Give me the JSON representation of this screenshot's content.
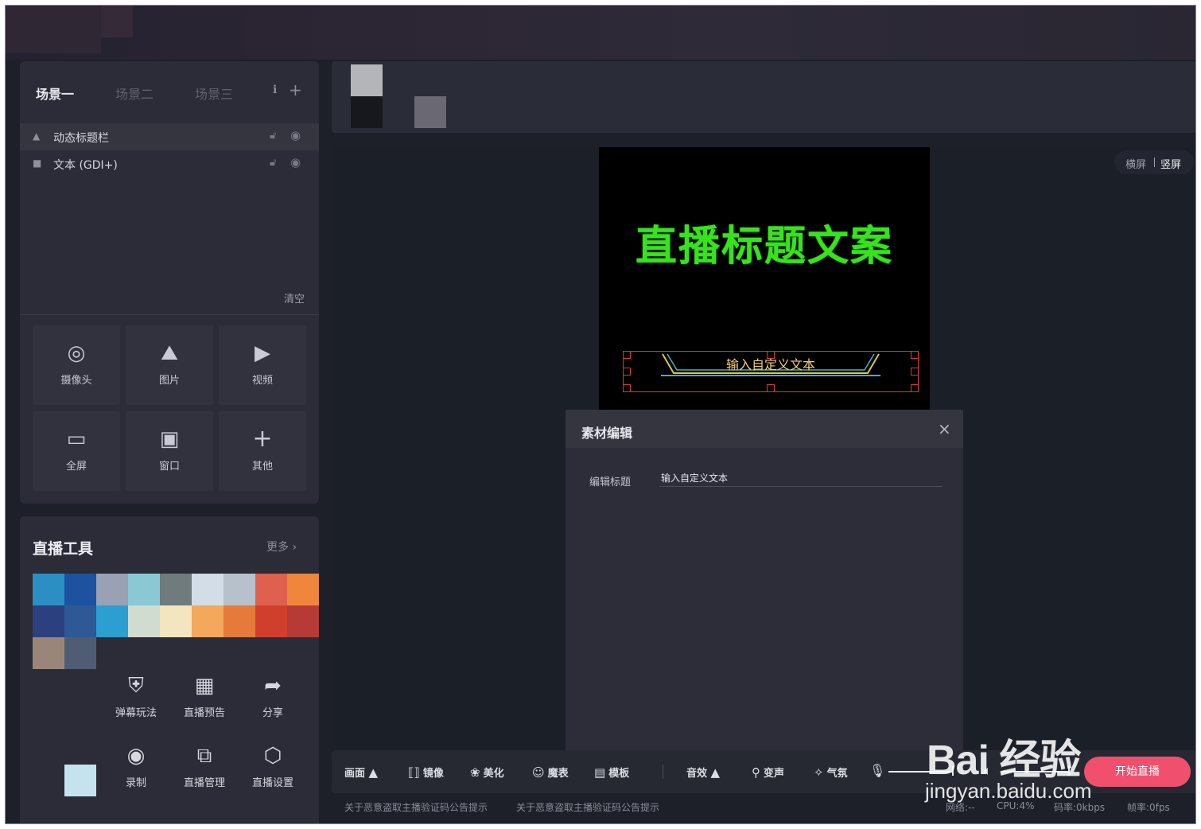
{
  "scenes": {
    "tabs": [
      "场景一",
      "场景二",
      "场景三"
    ],
    "sources": [
      {
        "label": "动态标题栏",
        "icon": "image-icon"
      },
      {
        "label": "文本 (GDI+)",
        "icon": "text-icon"
      }
    ],
    "clear_label": "清空",
    "add_buttons": [
      "摄像头",
      "图片",
      "视频",
      "全屏",
      "窗口",
      "其他"
    ]
  },
  "tools": {
    "title": "直播工具",
    "more": "更多",
    "items": [
      "弹幕玩法",
      "直播预告",
      "分享",
      "录制",
      "直播管理",
      "直播设置"
    ]
  },
  "orientation": {
    "landscape": "横屏",
    "portrait": "竖屏"
  },
  "preview": {
    "title_text": "直播标题文案",
    "banner_text": "输入自定义文本"
  },
  "dialog": {
    "title": "素材编辑",
    "field_label": "编辑标题",
    "field_value": "输入自定义文本"
  },
  "toolbar": {
    "canvas": "画面",
    "mirror": "镜像",
    "beauty": "美化",
    "emoji": "魔表",
    "template": "模板",
    "sound_fx": "音效",
    "voice_change": "变声",
    "atmosphere": "气氛",
    "start_live": "开始直播"
  },
  "status": {
    "notice1": "关于恶意盗取主播验证码公告提示",
    "notice2": "关于恶意盗取主播验证码公告提示",
    "network": "网络:--",
    "cpu": "CPU:4%",
    "bitrate": "码率:0kbps",
    "fps": "帧率:0fps"
  },
  "watermark": {
    "logo": "Bai 经验",
    "url": "jingyan.baidu.com"
  },
  "colors": {
    "accent": "#f0506e",
    "title_green": "#39e21f",
    "panel": "#2b2c37"
  }
}
